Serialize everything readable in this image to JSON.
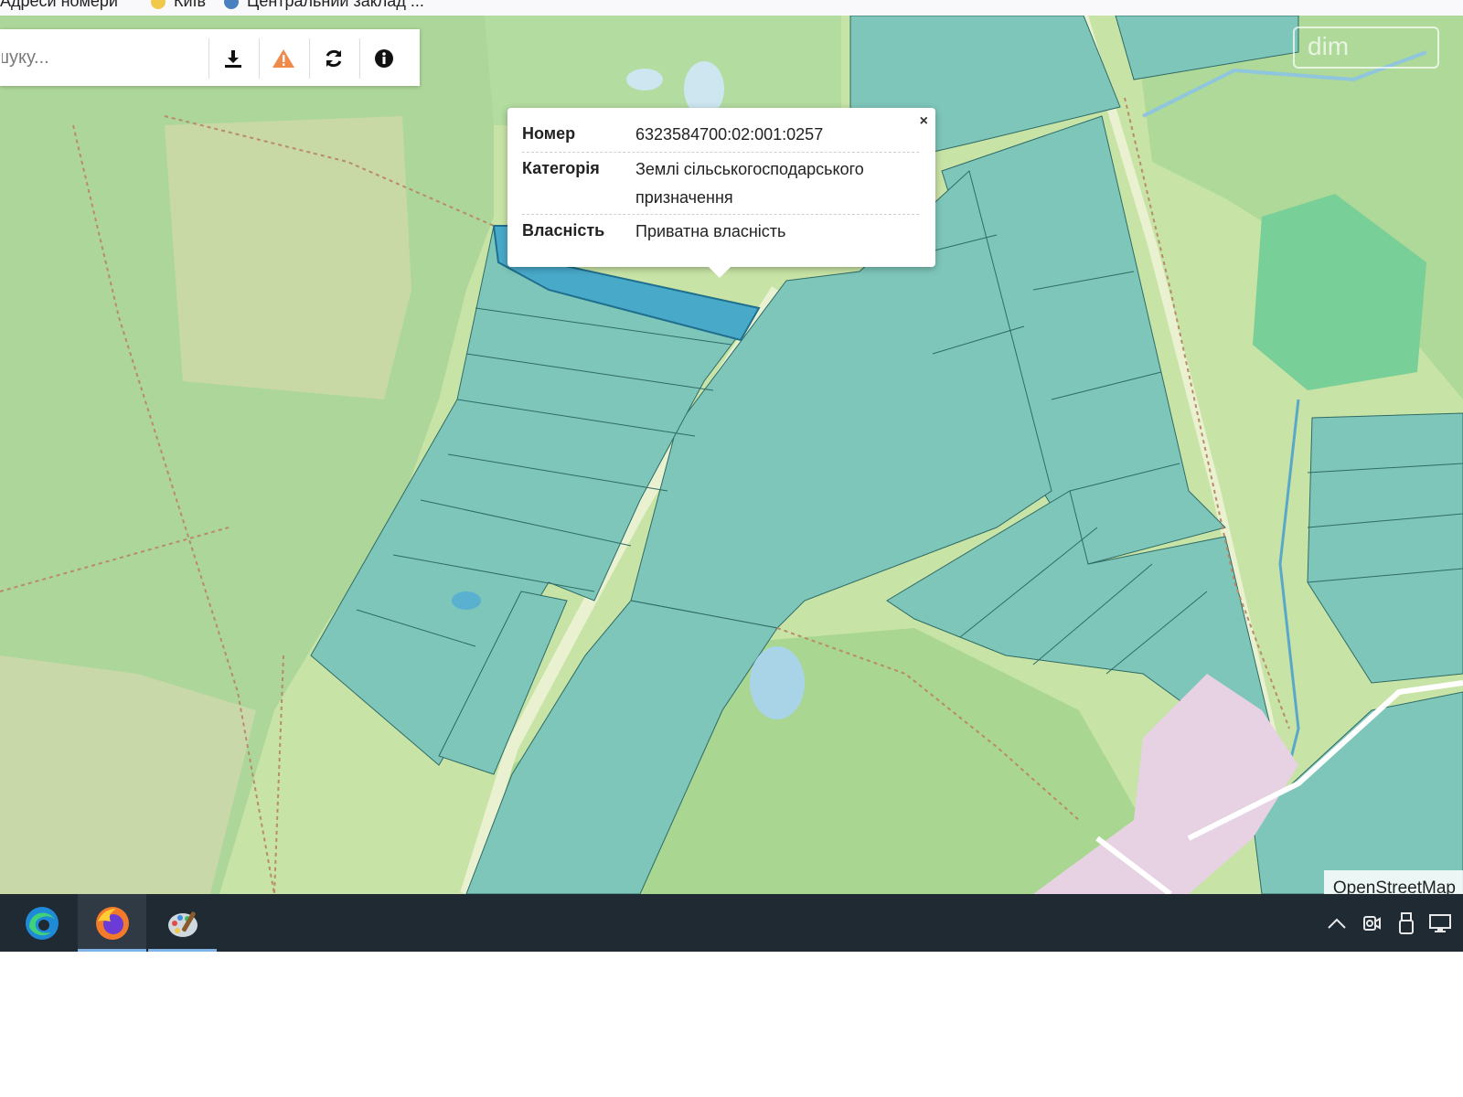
{
  "bookmarks": [
    "Адреси номери",
    "Київ",
    "Центральний заклад ..."
  ],
  "toolbar": {
    "search_placeholder": "шуку...",
    "download_icon": "download-icon",
    "warning_icon": "warning-icon",
    "refresh_icon": "refresh-icon",
    "info_icon": "info-icon"
  },
  "popup": {
    "close_label": "×",
    "rows": [
      {
        "key": "Номер",
        "value": "6323584700:02:001:0257"
      },
      {
        "key": "Категорія",
        "value": "Землі сільськогосподарського призначення"
      },
      {
        "key": "Власність",
        "value": "Приватна власність"
      }
    ]
  },
  "map": {
    "attribution": "OpenStreetMap",
    "watermark": "dim",
    "colors": {
      "forest": "#addb95",
      "field": "#c7e3a5",
      "parcel": "#7ec6ba",
      "selected": "#49a9c9",
      "water": "#a9d3e7",
      "industrial": "#e9d3e3"
    }
  },
  "taskbar": {
    "apps": [
      "edge-icon",
      "firefox-icon",
      "paint-icon"
    ],
    "tray": [
      "chevron-up-icon",
      "camera-icon",
      "usb-icon",
      "network-icon"
    ]
  }
}
